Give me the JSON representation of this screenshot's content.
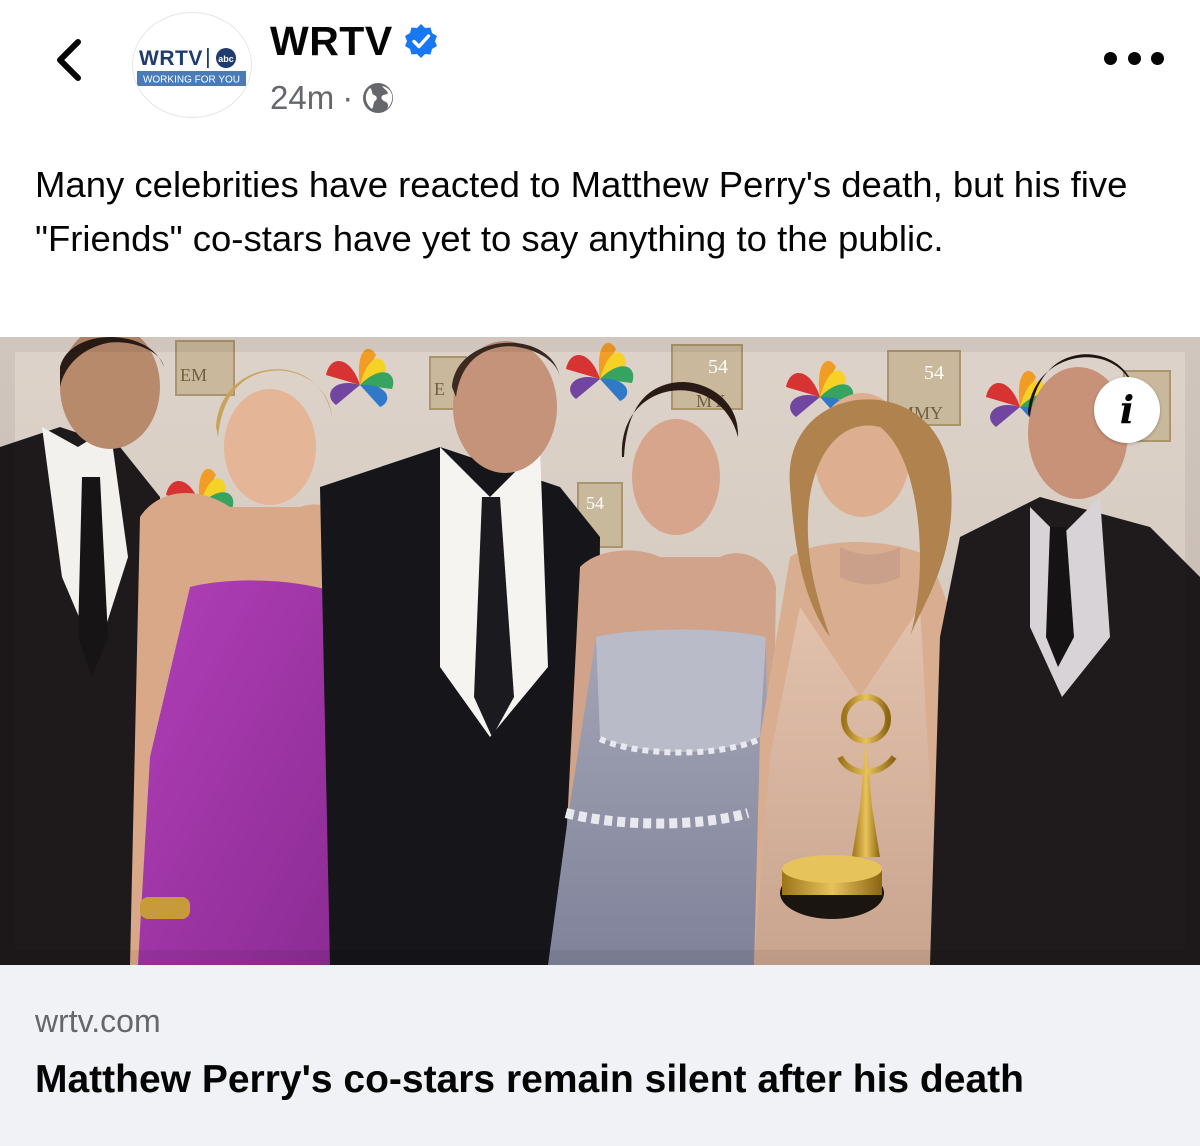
{
  "header": {
    "back_icon": "chevron-left-icon",
    "avatar": {
      "logo_text": "WRTV",
      "network_text": "abc",
      "tagline": "WORKING FOR YOU",
      "colors": {
        "wordmark": "#1f3c6e",
        "tagline_bg": "#4a7bb7"
      }
    },
    "page_name": "WRTV",
    "verified_icon": "verified-badge-icon",
    "verified_color": "#1877f2",
    "timestamp": "24m",
    "separator": "·",
    "audience_icon": "globe-icon",
    "more_icon": "more-options-icon"
  },
  "post": {
    "text": "Many celebrities have reacted to Matthew Perry's death, but his five \"Friends\" co-stars have yet to say anything to the public."
  },
  "link_preview": {
    "image_description_icon": "info-icon",
    "info_label": "i",
    "domain": "wrtv.com",
    "title": "Matthew Perry's co-stars remain silent after his death",
    "backdrop_fragments": [
      "EM",
      "E",
      "54",
      "MY",
      "MMY"
    ],
    "colors": {
      "card_bg": "#f0f2f5",
      "secondary_text": "#65676b"
    }
  }
}
